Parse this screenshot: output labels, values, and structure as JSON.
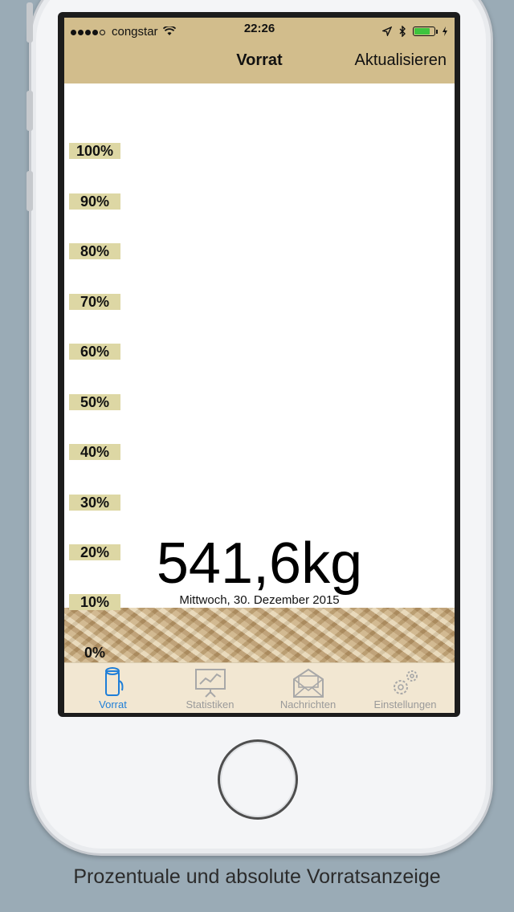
{
  "status_bar": {
    "carrier": "congstar",
    "time": "22:26",
    "battery_color": "#3ec43e"
  },
  "nav": {
    "title": "Vorrat",
    "action": "Aktualisieren"
  },
  "scale_labels": [
    "100%",
    "90%",
    "80%",
    "70%",
    "60%",
    "50%",
    "40%",
    "30%",
    "20%",
    "10%",
    "0%"
  ],
  "fill_level": "541,6kg",
  "date": "Mittwoch, 30. Dezember 2015",
  "tabs": [
    {
      "label": "Vorrat",
      "icon": "log-icon",
      "active": true
    },
    {
      "label": "Statistiken",
      "icon": "chart-board-icon",
      "active": false
    },
    {
      "label": "Nachrichten",
      "icon": "envelope-icon",
      "active": false
    },
    {
      "label": "Einstellungen",
      "icon": "gear-icon",
      "active": false
    }
  ],
  "caption": "Prozentuale und absolute Vorratsanzeige",
  "colors": {
    "navbar": "#d2bd8c",
    "scale_label_bg": "#ddd7a4",
    "tab_active": "#1e7ed8",
    "tabbar_bg": "#f2e7d2"
  }
}
